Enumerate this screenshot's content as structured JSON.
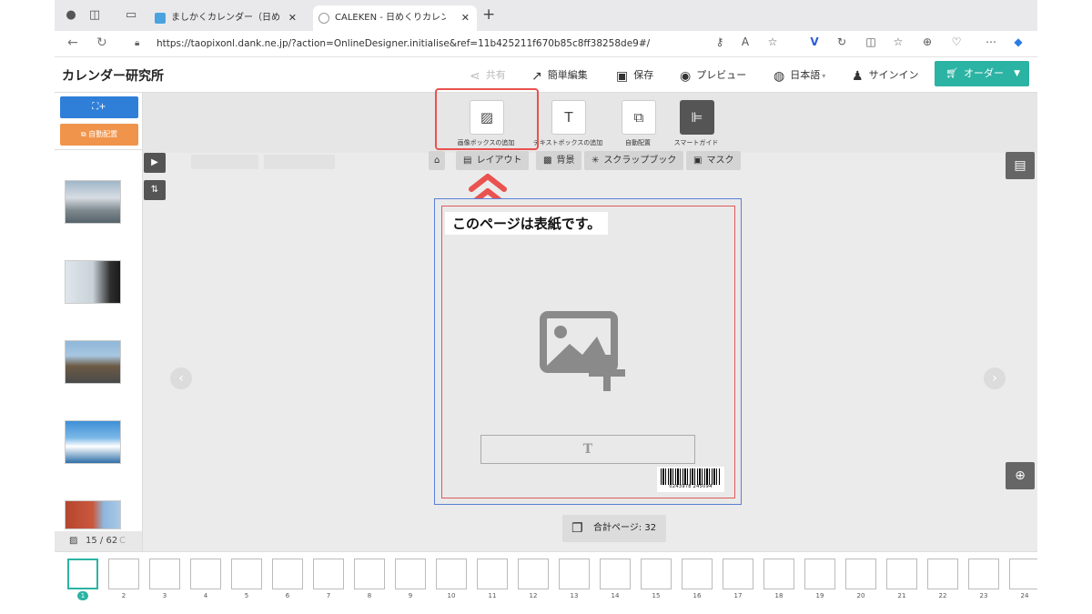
{
  "browser": {
    "tabs": [
      {
        "title": "ましかくカレンダー（日めくり）・",
        "active": false
      },
      {
        "title": "CALEKEN - 日めくりカレンダーま",
        "active": true
      }
    ],
    "url": "https://taopixonl.dank.ne.jp/?action=OnlineDesigner.initialise&ref=11b425211f670b85c8ff38258de9#/"
  },
  "header": {
    "logo": "カレンダー研究所",
    "share_label": "共有",
    "easy_edit_label": "簡単編集",
    "save_label": "保存",
    "preview_label": "プレビュー",
    "language_label": "日本語",
    "signin_label": "サインイン",
    "order_label": "オーダー",
    "accent_color": "#2bb3a3"
  },
  "left_panel": {
    "add_image_label": "+",
    "auto_place_label": "自動配置",
    "counter": "15 / 62"
  },
  "toolbar": {
    "add_image_box": "画像ボックスの追加",
    "add_text_box": "テキストボックスの追加",
    "auto_layout": "自動配置",
    "smart_guide": "スマートガイド"
  },
  "subtabs": {
    "layout": "レイアウト",
    "background": "背景",
    "scrapbook": "スクラップブック",
    "mask": "マスク"
  },
  "page": {
    "cover_text": "このページは表紙です。",
    "text_placeholder": "T",
    "barcode_number": "0243978 245094",
    "total_pages": "合計ページ: 32"
  },
  "filmstrip": {
    "selected": "1",
    "labels": [
      "1",
      "2",
      "3",
      "4",
      "5",
      "6",
      "7",
      "8",
      "9",
      "10",
      "11",
      "12",
      "13",
      "14",
      "15",
      "16",
      "17",
      "18",
      "19",
      "20",
      "21",
      "22",
      "23",
      "24"
    ]
  }
}
